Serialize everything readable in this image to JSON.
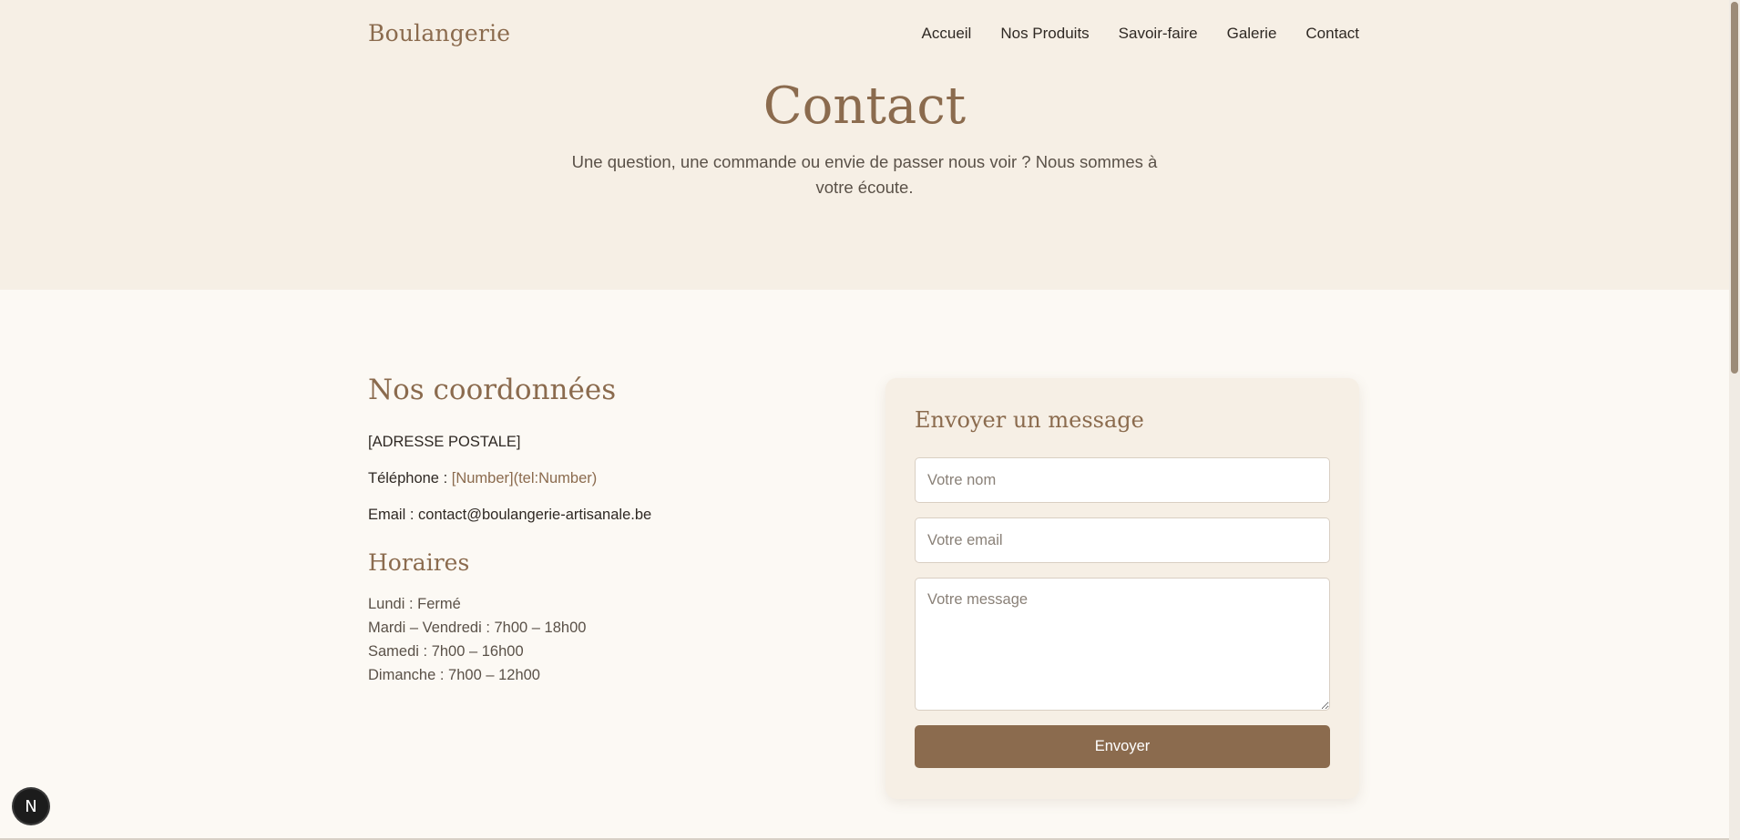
{
  "header": {
    "brand": "Boulangerie",
    "nav": [
      "Accueil",
      "Nos Produits",
      "Savoir-faire",
      "Galerie",
      "Contact"
    ]
  },
  "hero": {
    "title": "Contact",
    "subtitle": "Une question, une commande ou envie de passer nous voir ? Nous sommes à votre écoute."
  },
  "info": {
    "title": "Nos coordonnées",
    "address": "[ADRESSE POSTALE]",
    "phone_label": "Téléphone : ",
    "phone_value": "[Number](tel:Number)",
    "email_label": "Email : ",
    "email_value": "contact@boulangerie-artisanale.be",
    "hours_title": "Horaires",
    "hours": [
      "Lundi : Fermé",
      "Mardi – Vendredi : 7h00 – 18h00",
      "Samedi : 7h00 – 16h00",
      "Dimanche : 7h00 – 12h00"
    ]
  },
  "form": {
    "title": "Envoyer un message",
    "name_placeholder": "Votre nom",
    "email_placeholder": "Votre email",
    "message_placeholder": "Votre message",
    "submit_label": "Envoyer"
  },
  "badge": {
    "label": "N"
  },
  "colors": {
    "accent": "#8b6b4e",
    "hero_bg": "#f6efe5",
    "page_bg": "#fcf9f4"
  }
}
